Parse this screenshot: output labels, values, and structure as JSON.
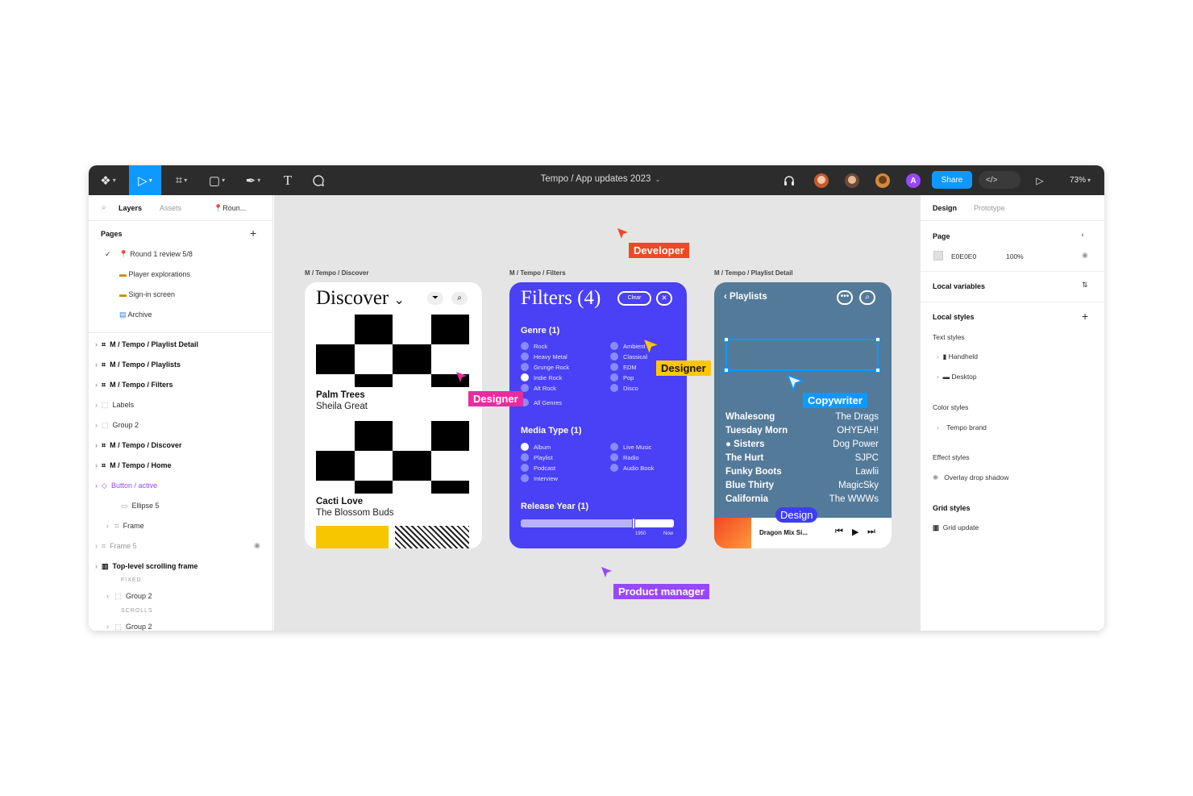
{
  "toolbar": {
    "title": "Tempo / App updates 2023",
    "title_caret": "⌄",
    "share_label": "Share",
    "code_icon": "</>",
    "zoom": "73%",
    "caret": "▾",
    "avatar_letter": "A"
  },
  "left_panel": {
    "tabs": {
      "layers": "Layers",
      "assets": "Assets",
      "page_tab": "Roun..."
    },
    "pages_header": "Pages",
    "add": "+",
    "pages": [
      {
        "label": "Round 1 review 5/8"
      },
      {
        "label": "Player explorations"
      },
      {
        "label": "Sign-in screen"
      },
      {
        "label": "Archive"
      }
    ],
    "layers": [
      {
        "label": "M / Tempo / Playlist Detail"
      },
      {
        "label": "M / Tempo / Playlists"
      },
      {
        "label": "M / Tempo / Filters"
      },
      {
        "label": "Labels"
      },
      {
        "label": "Group 2"
      },
      {
        "label": "M / Tempo / Discover"
      },
      {
        "label": "M / Tempo / Home"
      },
      {
        "label": "Button / active"
      },
      {
        "label": "Ellipse 5"
      },
      {
        "label": "Frame"
      },
      {
        "label": "Frame 5"
      },
      {
        "label": "Top-level scrolling frame"
      },
      {
        "label": "FIXED"
      },
      {
        "label": "Group 2"
      },
      {
        "label": "SCROLLS"
      },
      {
        "label": "Group 2"
      }
    ]
  },
  "canvas": {
    "frames": [
      {
        "label": "M / Tempo / Discover"
      },
      {
        "label": "M / Tempo / Filters"
      },
      {
        "label": "M / Tempo / Playlist Detail"
      }
    ],
    "discover": {
      "title": "Discover",
      "chevron": "⌄",
      "tracks": [
        {
          "title": "Palm Trees",
          "artist": "Sheila Great"
        },
        {
          "title": "Cacti Love",
          "artist": "The Blossom Buds"
        }
      ]
    },
    "filters": {
      "title": "Filters (4)",
      "clear": "Clear",
      "close": "×",
      "genre_header": "Genre (1)",
      "genres": [
        "Rock",
        "Heavy Metal",
        "Grunge Rock",
        "Indie Rock",
        "Alt Rock",
        "Ambient",
        "Classical",
        "EDM",
        "Pop",
        "Disco"
      ],
      "all_genres": "All Genres",
      "media_header": "Media Type (1)",
      "media": [
        "Album",
        "Playlist",
        "Podcast",
        "Interview",
        "Live Music",
        "Radio",
        "Audio Book"
      ],
      "year_header": "Release Year (1)",
      "year_from": "1950",
      "year_to": "Now"
    },
    "playlist": {
      "back": "Playlists",
      "songs_left": [
        "Whalesong",
        "Tuesday Morn",
        "Sisters",
        "The Hurt",
        "Funky Boots",
        "Blue Thirty",
        "California"
      ],
      "songs_right": [
        "The Drags",
        "OHYEAH!",
        "Dog Power",
        "SJPC",
        "Lawlii",
        "MagicSky",
        "The WWWs"
      ],
      "now_playing": "Dragon Mix Si..."
    },
    "cursors": [
      {
        "label": "Developer",
        "color": "#f24822"
      },
      {
        "label": "Designer",
        "color": "#e82ca0"
      },
      {
        "label": "Designer",
        "color": "#ffc700"
      },
      {
        "label": "Copywriter",
        "color": "#0d99ff"
      },
      {
        "label": "Design",
        "color": "#3e3ef0"
      },
      {
        "label": "Product manager",
        "color": "#9747ff"
      }
    ]
  },
  "right_panel": {
    "tabs": {
      "design": "Design",
      "prototype": "Prototype"
    },
    "page_header": "Page",
    "page_color": "E0E0E0",
    "page_opacity": "100%",
    "local_variables": "Local variables",
    "local_styles": "Local styles",
    "text_styles_header": "Text styles",
    "text_styles": [
      "Handheld",
      "Desktop"
    ],
    "color_styles_header": "Color styles",
    "color_styles": [
      "Tempo brand"
    ],
    "effect_styles_header": "Effect styles",
    "effect_styles": [
      "Overlay drop shadow"
    ],
    "grid_styles_header": "Grid styles",
    "grid_styles": [
      "Grid update"
    ],
    "add": "+"
  }
}
